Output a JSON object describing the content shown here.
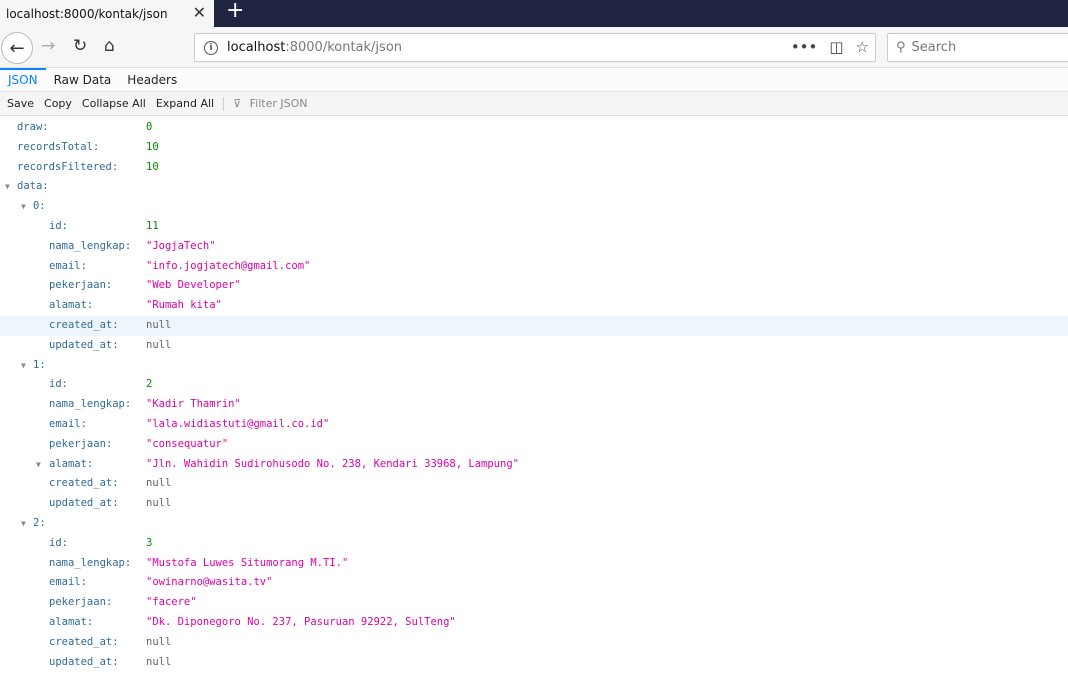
{
  "browser": {
    "tab_title": "localhost:8000/kontak/json",
    "url_host": "localhost",
    "url_path": ":8000/kontak/json",
    "search_placeholder": "Search"
  },
  "viewer_tabs": [
    "JSON",
    "Raw Data",
    "Headers"
  ],
  "toolbar": {
    "save": "Save",
    "copy": "Copy",
    "collapse_all": "Collapse All",
    "expand_all": "Expand All",
    "filter_placeholder": "Filter JSON"
  },
  "json": {
    "draw": "0",
    "recordsTotal": "10",
    "recordsFiltered": "10",
    "data": [
      {
        "id": "11",
        "nama_lengkap": "\"JogjaTech\"",
        "email": "\"info.jogjatech@gmail.com\"",
        "pekerjaan": "\"Web Developer\"",
        "alamat": "\"Rumah kita\"",
        "created_at": "null",
        "updated_at": "null"
      },
      {
        "id": "2",
        "nama_lengkap": "\"Kadir Thamrin\"",
        "email": "\"lala.widiastuti@gmail.co.id\"",
        "pekerjaan": "\"consequatur\"",
        "alamat": "\"Jln. Wahidin Sudirohusodo No. 238, Kendari 33968, Lampung\"",
        "created_at": "null",
        "updated_at": "null"
      },
      {
        "id": "3",
        "nama_lengkap": "\"Mustofa Luwes Situmorang M.TI.\"",
        "email": "\"owinarno@wasita.tv\"",
        "pekerjaan": "\"facere\"",
        "alamat": "\"Dk. Diponegoro No. 237, Pasuruan 92922, SulTeng\"",
        "created_at": "null",
        "updated_at": "null"
      }
    ]
  }
}
